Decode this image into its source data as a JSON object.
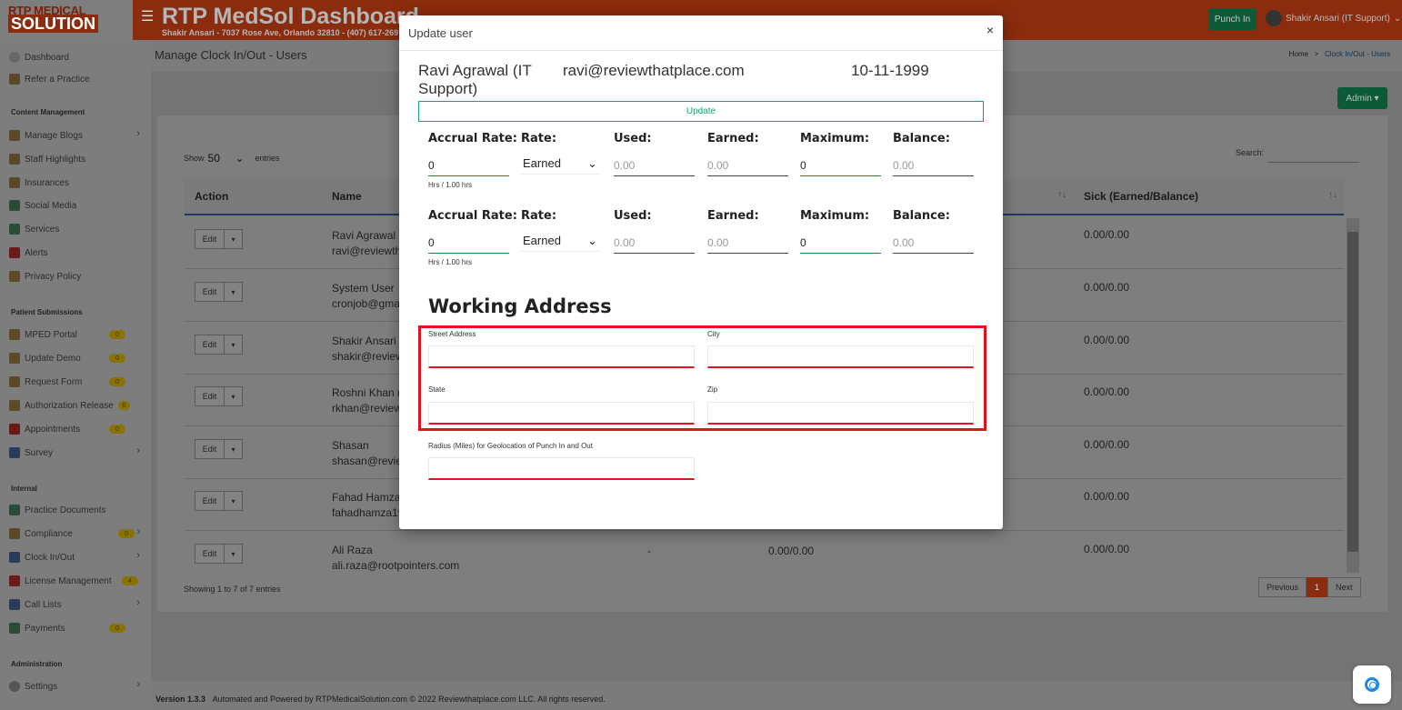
{
  "app": {
    "logo_line1": "RTP MEDICAL",
    "logo_line2": "SOLUTION",
    "title": "RTP MedSol Dashboard",
    "subtitle": "Shakir Ansari - 7037 Rose Ave, Orlando 32810 - (407) 617-269",
    "punch_in": "Punch In",
    "user": "Shakir Ansari (IT Support)"
  },
  "sidebar": {
    "top_items": [
      {
        "label": "Dashboard"
      },
      {
        "label": "Refer a Practice"
      }
    ],
    "section_content": "Content Management",
    "content_items": [
      {
        "label": "Manage Blogs"
      },
      {
        "label": "Staff Highlights"
      },
      {
        "label": "Insurances"
      },
      {
        "label": "Social Media"
      },
      {
        "label": "Services"
      },
      {
        "label": "Alerts"
      },
      {
        "label": "Privacy Policy"
      }
    ],
    "section_patient": "Patient Submissions",
    "patient_items": [
      {
        "label": "MPED Portal",
        "badge": "0"
      },
      {
        "label": "Update Demo",
        "badge": "0"
      },
      {
        "label": "Request Form",
        "badge": "0"
      },
      {
        "label": "Authorization Release",
        "badge": "0"
      },
      {
        "label": "Appointments",
        "badge": "0"
      },
      {
        "label": "Survey"
      }
    ],
    "section_internal": "Internal",
    "internal_items": [
      {
        "label": "Practice Documents"
      },
      {
        "label": "Compliance",
        "badge": "0"
      },
      {
        "label": "Clock In/Out"
      },
      {
        "label": "License Management",
        "badge": "4"
      },
      {
        "label": "Call Lists"
      },
      {
        "label": "Payments",
        "badge": "0"
      }
    ],
    "section_admin": "Administration",
    "admin_items": [
      {
        "label": "Settings"
      }
    ]
  },
  "page": {
    "heading": "Manage Clock In/Out - Users",
    "crumb_home": "Home",
    "crumb_sep": ">",
    "crumb_current": "Clock In/Out - Users",
    "admin_btn": "Admin",
    "show_label": "Show",
    "show_value": "50",
    "entries_label": "entries",
    "search_label": "Search:",
    "columns": {
      "action": "Action",
      "name": "Name",
      "sick": "Sick (Earned/Balance)"
    },
    "rows": [
      {
        "name": "Ravi Agrawal (",
        "email": "ravi@reviewtha",
        "sick": "0.00/0.00"
      },
      {
        "name": "System User",
        "email": "cronjob@gmai",
        "sick": "0.00/0.00"
      },
      {
        "name": "Shakir Ansari (",
        "email": "shakir@review",
        "sick": "0.00/0.00"
      },
      {
        "name": "Roshni Khan (I",
        "email": "rkhan@review",
        "sick": "0.00/0.00"
      },
      {
        "name": "Shasan",
        "email": "shasan@reviev",
        "sick": "0.00/0.00"
      },
      {
        "name": "Fahad Hamza",
        "email": "fahadhamza19",
        "sick": "0.00/0.00"
      },
      {
        "name": "Ali Raza",
        "email": "ali.raza@rootpointers.com",
        "sick": "0.00/0.00",
        "dash": "-",
        "annual": "0.00/0.00"
      }
    ],
    "edit_label": "Edit",
    "showing": "Showing 1 to 7 of 7 entries",
    "pager": {
      "previous": "Previous",
      "current": "1",
      "next": "Next"
    },
    "footer_version": "Version 1.3.3",
    "footer_text": "Automated and Powered by RTPMedicalSolution.com © 2022 Reviewthatplace.com LLC. All rights reserved."
  },
  "modal": {
    "title": "Update user",
    "close": "×",
    "user_name": "Ravi Agrawal (IT Support)",
    "user_email": "ravi@reviewthatplace.com",
    "user_dob": "10-11-1999",
    "update_btn": "Update",
    "labels": {
      "accrual": "Accrual Rate:",
      "rate": "Rate:",
      "used": "Used:",
      "earned": "Earned:",
      "maximum": "Maximum:",
      "balance": "Balance:"
    },
    "accrual_rows": [
      {
        "accrual": "0",
        "hrs_note": "Hrs / 1.00 hrs",
        "rate": "Earned",
        "used": "0.00",
        "earned": "0.00",
        "maximum": "0",
        "balance": "0.00"
      },
      {
        "accrual": "0",
        "hrs_note": "Hrs / 1.00 hrs",
        "rate": "Earned",
        "used": "0.00",
        "earned": "0.00",
        "maximum": "0",
        "balance": "0.00"
      }
    ],
    "working_address_title": "Working Address",
    "street_label": "Street Address",
    "city_label": "City",
    "state_label": "State",
    "zip_label": "Zip",
    "radius_label": "Radius (Miles) for Geolocation of Punch In and Out",
    "highlight_color": "#e0141e",
    "accent_color": "#0fa66e"
  }
}
